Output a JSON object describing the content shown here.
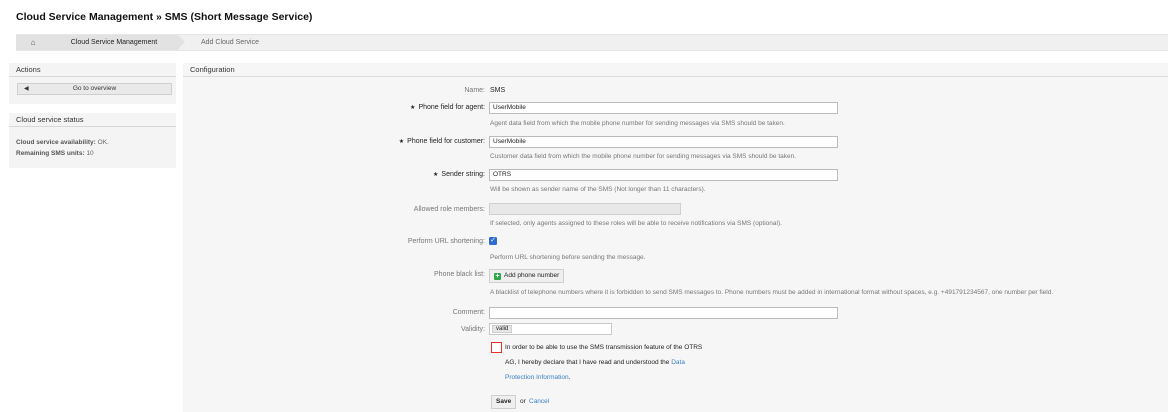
{
  "page": {
    "title": "Cloud Service Management » SMS (Short Message Service)"
  },
  "breadcrumb": {
    "items": [
      "Cloud Service Management",
      "Add Cloud Service"
    ]
  },
  "sidebar": {
    "actions": {
      "header": "Actions",
      "go_to_overview": "Go to overview"
    },
    "status": {
      "header": "Cloud service status",
      "availability_label": "Cloud service availability:",
      "availability_value": "OK.",
      "units_label": "Remaining SMS units:",
      "units_value": "10"
    }
  },
  "config": {
    "header": "Configuration",
    "name": {
      "label": "Name:",
      "value": "SMS"
    },
    "phone_agent": {
      "label": "Phone field for agent:",
      "value": "UserMobile",
      "hint": "Agent data field from which the mobile phone number for sending messages via SMS should be taken."
    },
    "phone_customer": {
      "label": "Phone field for customer:",
      "value": "UserMobile",
      "hint": "Customer data field from which the mobile phone number for sending messages via SMS should be taken."
    },
    "sender": {
      "label": "Sender string:",
      "value": "OTRS",
      "hint": "Will be shown as sender name of the SMS (Not longer than 11 characters)."
    },
    "roles": {
      "label": "Allowed role members:",
      "hint": "If selected, only agents assigned to these roles will be able to receive notifications via SMS (optional)."
    },
    "url_shortening": {
      "label": "Perform URL shortening:",
      "checked": true,
      "hint": "Perform URL shortening before sending the message."
    },
    "blacklist": {
      "label": "Phone black list:",
      "button": "Add phone number",
      "hint": "A blacklist of telephone numbers where it is forbidden to send SMS messages to. Phone numbers must be added in international format without spaces, e.g. +491791234567, one number per field."
    },
    "comment": {
      "label": "Comment:",
      "value": ""
    },
    "validity": {
      "label": "Validity:",
      "value": "valid"
    },
    "declaration": {
      "line1": "In order to be able to use the SMS transmission feature of the OTRS",
      "line2_prefix": "AG, I hereby declare that I have read and understood the",
      "link_part1": "Data",
      "link_part2": "Protection Information",
      "line3_suffix": "."
    },
    "actions": {
      "save": "Save",
      "or": "or",
      "cancel": "Cancel"
    }
  }
}
